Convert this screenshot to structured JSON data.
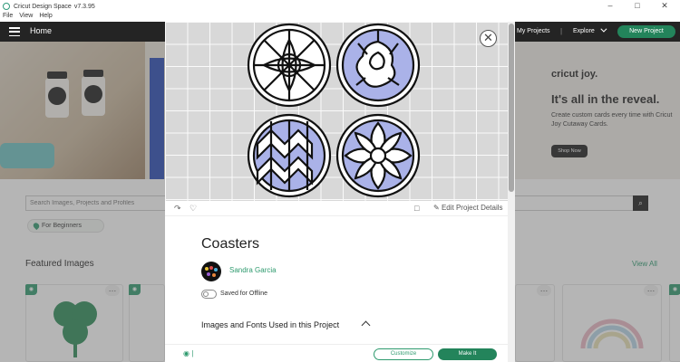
{
  "window": {
    "title": "Cricut Design Space",
    "version": "v7.3.95",
    "menu": [
      "File",
      "View",
      "Help"
    ]
  },
  "header": {
    "home_label": "Home",
    "my_projects_label": "My Projects",
    "separator": "|",
    "explore_label": "Explore",
    "new_project_label": "New Project"
  },
  "ad": {
    "brand": "cricut joy.",
    "headline": "It's all in the reveal.",
    "subtext": "Create custom cards every time with Cricut Joy Cutaway Cards.",
    "shop_label": "Shop Now"
  },
  "search": {
    "placeholder": "Search Images, Projects and Profiles"
  },
  "filter_chip": {
    "label": "For Beginners"
  },
  "featured": {
    "title": "Featured Images",
    "view_all": "View All"
  },
  "modal": {
    "edit_link": "Edit Project Details",
    "project_title": "Coasters",
    "author": "Sandra Garcia",
    "offline_label": "Saved for Offline",
    "section_title": "Images and Fonts Used in this Project",
    "customize_label": "Customize",
    "make_it_label": "Make It"
  },
  "colors": {
    "accent": "#2e9a6e",
    "primary_button": "#23845b",
    "header_bg": "#242424",
    "coaster_fill": "#aab2e8"
  },
  "icons": [
    "hamburger-icon",
    "chevron-down-icon",
    "search-icon",
    "close-icon",
    "share-icon",
    "heart-icon",
    "bookmark-icon",
    "pencil-icon",
    "lock-icon",
    "more-icon"
  ]
}
